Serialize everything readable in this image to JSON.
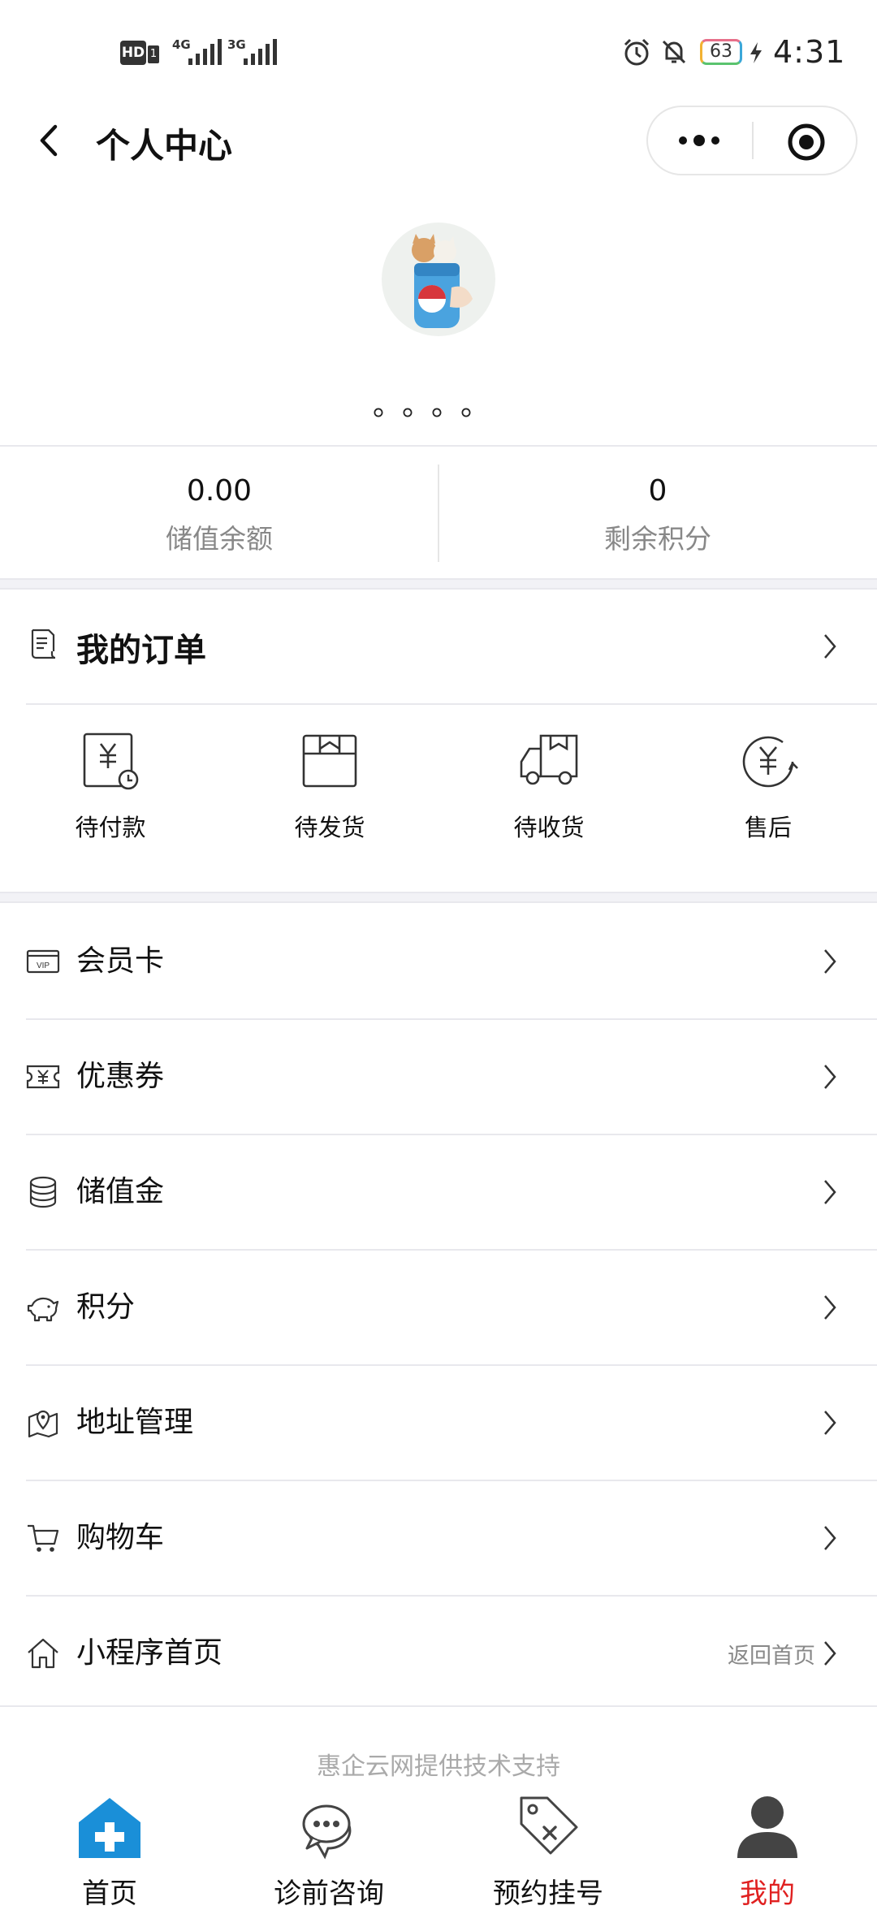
{
  "status_bar": {
    "hd": "HD",
    "sim_slot": "1",
    "net_1": "4G",
    "net_2": "3G",
    "battery": "63",
    "time": "4:31"
  },
  "header": {
    "title": "个人中心"
  },
  "profile": {
    "nickname": "。。。。"
  },
  "stats": [
    {
      "value": "0.00",
      "label": "储值余额"
    },
    {
      "value": "0",
      "label": "剩余积分"
    }
  ],
  "orders": {
    "title": "我的订单",
    "items": [
      {
        "label": "待付款",
        "icon": "pending-payment-icon"
      },
      {
        "label": "待发货",
        "icon": "pending-shipment-icon"
      },
      {
        "label": "待收货",
        "icon": "pending-receipt-icon"
      },
      {
        "label": "售后",
        "icon": "after-sales-icon"
      }
    ]
  },
  "menu": [
    {
      "label": "会员卡",
      "icon": "vip-card-icon"
    },
    {
      "label": "优惠券",
      "icon": "coupon-icon"
    },
    {
      "label": "储值金",
      "icon": "coins-icon"
    },
    {
      "label": "积分",
      "icon": "piggy-bank-icon"
    },
    {
      "label": "地址管理",
      "icon": "location-icon"
    },
    {
      "label": "购物车",
      "icon": "cart-icon"
    },
    {
      "label": "小程序首页",
      "icon": "home-icon",
      "hint": "返回首页"
    }
  ],
  "footer": {
    "note": "惠企云网提供技术支持"
  },
  "tabs": [
    {
      "label": "首页",
      "icon": "medical-cross-icon"
    },
    {
      "label": "诊前咨询",
      "icon": "chat-bubbles-icon"
    },
    {
      "label": "预约挂号",
      "icon": "tag-icon"
    },
    {
      "label": "我的",
      "icon": "user-icon",
      "active": true
    }
  ],
  "colors": {
    "accent": "#1a8fd8",
    "active_tab": "#e02020",
    "text": "#111111",
    "muted": "#888888"
  }
}
